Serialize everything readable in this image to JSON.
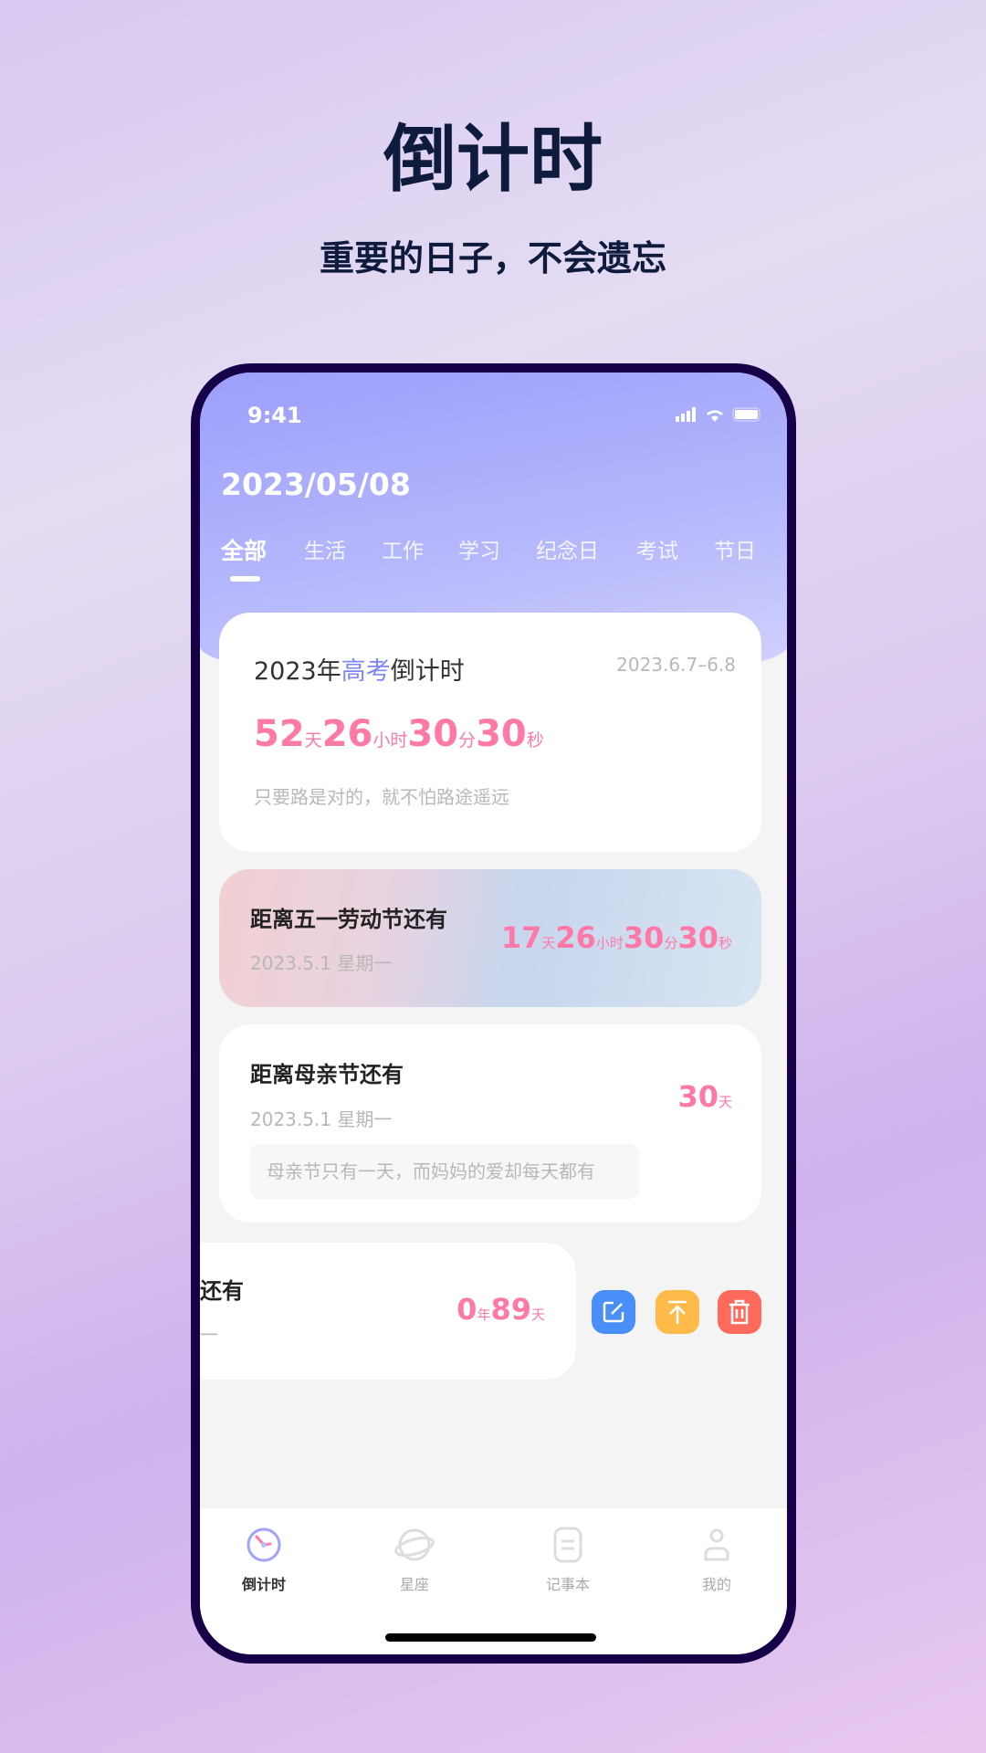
{
  "promo": {
    "title": "倒计时",
    "subtitle": "重要的日子，不会遗忘"
  },
  "status_bar": {
    "time": "9:41"
  },
  "header": {
    "date": "2023/05/08",
    "tabs": [
      {
        "label": "全部",
        "active": true
      },
      {
        "label": "生活"
      },
      {
        "label": "工作"
      },
      {
        "label": "学习"
      },
      {
        "label": "纪念日"
      },
      {
        "label": "考试"
      },
      {
        "label": "节日"
      }
    ]
  },
  "cards": [
    {
      "title_pre": "2023年",
      "title_hl": "高考",
      "title_post": "倒计时",
      "range": "2023.6.7–6.8",
      "count": [
        {
          "n": "52",
          "u": "天"
        },
        {
          "n": "26",
          "u": "小时"
        },
        {
          "n": "30",
          "u": "分"
        },
        {
          "n": "30",
          "u": "秒"
        }
      ],
      "note": "只要路是对的，就不怕路途遥远"
    },
    {
      "title": "距离五一劳动节还有",
      "date": "2023.5.1 星期一",
      "count": [
        {
          "n": "17",
          "u": "天"
        },
        {
          "n": "26",
          "u": "小时"
        },
        {
          "n": "30",
          "u": "分"
        },
        {
          "n": "30",
          "u": "秒"
        }
      ]
    },
    {
      "title": "距离母亲节还有",
      "date": "2023.5.1 星期一",
      "count": [
        {
          "n": "30",
          "u": "天"
        }
      ],
      "note": "母亲节只有一天，而妈妈的爱却每天都有"
    },
    {
      "title": "还有",
      "date": "一",
      "count": [
        {
          "n": "0",
          "u": "年"
        },
        {
          "n": "89",
          "u": "天"
        }
      ]
    }
  ],
  "swipe_actions": [
    {
      "icon": "edit-icon",
      "color": "#4a8ff8"
    },
    {
      "icon": "pin-top-icon",
      "color": "#ffbb4a"
    },
    {
      "icon": "trash-icon",
      "color": "#ff6a5c"
    }
  ],
  "fab": {
    "icon": "plus-icon",
    "color": "#7d85f7"
  },
  "tabbar": {
    "items": [
      {
        "label": "倒计时",
        "icon": "clock-icon",
        "active": true
      },
      {
        "label": "星座",
        "icon": "planet-icon"
      },
      {
        "label": "记事本",
        "icon": "notebook-icon"
      },
      {
        "label": "我的",
        "icon": "user-icon"
      }
    ]
  },
  "colors": {
    "accent": "#7d85f7",
    "count": "#ff79a6",
    "frame": "#160048"
  }
}
